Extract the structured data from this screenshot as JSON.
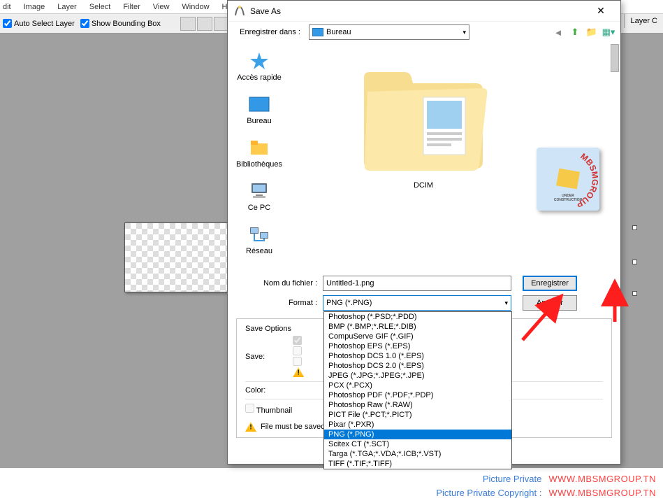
{
  "menubar": [
    "dit",
    "Image",
    "Layer",
    "Select",
    "Filter",
    "View",
    "Window",
    "He"
  ],
  "toolbar": {
    "auto_select": "Auto Select Layer",
    "show_bbox": "Show Bounding Box",
    "layer_tab": "Layer C"
  },
  "dialog": {
    "title": "Save As",
    "close": "✕",
    "location_label": "Enregistrer dans :",
    "location_value": "Bureau",
    "sidebar": [
      {
        "label": "Accès rapide",
        "icon": "star"
      },
      {
        "label": "Bureau",
        "icon": "desktop"
      },
      {
        "label": "Bibliothèques",
        "icon": "libraries"
      },
      {
        "label": "Ce PC",
        "icon": "pc"
      },
      {
        "label": "Réseau",
        "icon": "network"
      }
    ],
    "folder_label": "DCIM",
    "filename_label": "Nom du fichier :",
    "filename_value": "Untitled-1.png",
    "format_label": "Format :",
    "format_value": "PNG (*.PNG)",
    "format_options": [
      "Photoshop (*.PSD;*.PDD)",
      "BMP (*.BMP;*.RLE;*.DIB)",
      "CompuServe GIF (*.GIF)",
      "Photoshop EPS (*.EPS)",
      "Photoshop DCS 1.0 (*.EPS)",
      "Photoshop DCS 2.0 (*.EPS)",
      "JPEG (*.JPG;*.JPEG;*.JPE)",
      "PCX (*.PCX)",
      "Photoshop PDF (*.PDF;*.PDP)",
      "Photoshop Raw (*.RAW)",
      "PICT File (*.PCT;*.PICT)",
      "Pixar (*.PXR)",
      "PNG (*.PNG)",
      "Scitex CT (*.SCT)",
      "Targa (*.TGA;*.VDA;*.ICB;*.VST)",
      "TIFF (*.TIF;*.TIFF)"
    ],
    "btn_save": "Enregistrer",
    "btn_cancel": "Annuler",
    "options_title": "Save Options",
    "save_label": "Save:",
    "color_label": "Color:",
    "thumbnail_label": "Thumbnail",
    "warn_text": "File must be saved as a copy with this selection."
  },
  "footer": {
    "row1_left": "Picture Private",
    "row1_right": "WWW.MBSMGROUP.TN",
    "row2_left": "Picture Private Copyright :",
    "row2_right": "WWW.MBSMGROUP.TN"
  }
}
